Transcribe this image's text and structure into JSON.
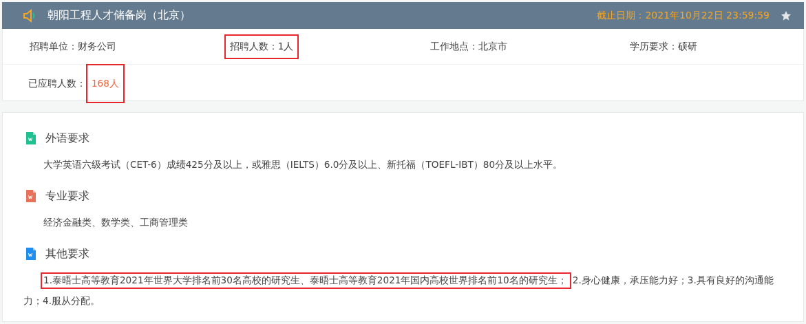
{
  "header": {
    "title": "朝阳工程人才储备岗（北京）",
    "deadline": "截止日期：2021年10月22日 23:59:59",
    "starred": false
  },
  "fields": [
    {
      "label": "招聘单位：",
      "value": "财务公司",
      "highlighted": false
    },
    {
      "label": "招聘人数：",
      "value": "1人",
      "highlighted": true
    },
    {
      "label": "工作地点：",
      "value": "北京市",
      "highlighted": false
    },
    {
      "label": "学历要求：",
      "value": "硕研",
      "highlighted": false
    }
  ],
  "applicants": {
    "label": "已应聘人数：",
    "value": "168人",
    "highlighted": true
  },
  "sections": [
    {
      "title": "外语要求",
      "color": "#1fc190",
      "segments": [
        {
          "text": "大学英语六级考试（CET-6）成绩425分及以上，或雅思（IELTS）6.0分及以上、新托福（TOEFL-IBT）80分及以上水平。",
          "highlighted": false
        }
      ]
    },
    {
      "title": "专业要求",
      "color": "#e8735a",
      "segments": [
        {
          "text": "经济金融类、数学类、工商管理类",
          "highlighted": false
        }
      ]
    },
    {
      "title": "其他要求",
      "color": "#1e8ff0",
      "segments": [
        {
          "text": "1.泰晤士高等教育2021年世界大学排名前30名高校的研究生、泰晤士高等教育2021年国内高校世界排名前10名的研究生；",
          "highlighted": true
        },
        {
          "text": "2.身心健康，承压能力好；3.具有良好的沟通能力；4.服从分配。",
          "highlighted": false
        }
      ]
    }
  ]
}
